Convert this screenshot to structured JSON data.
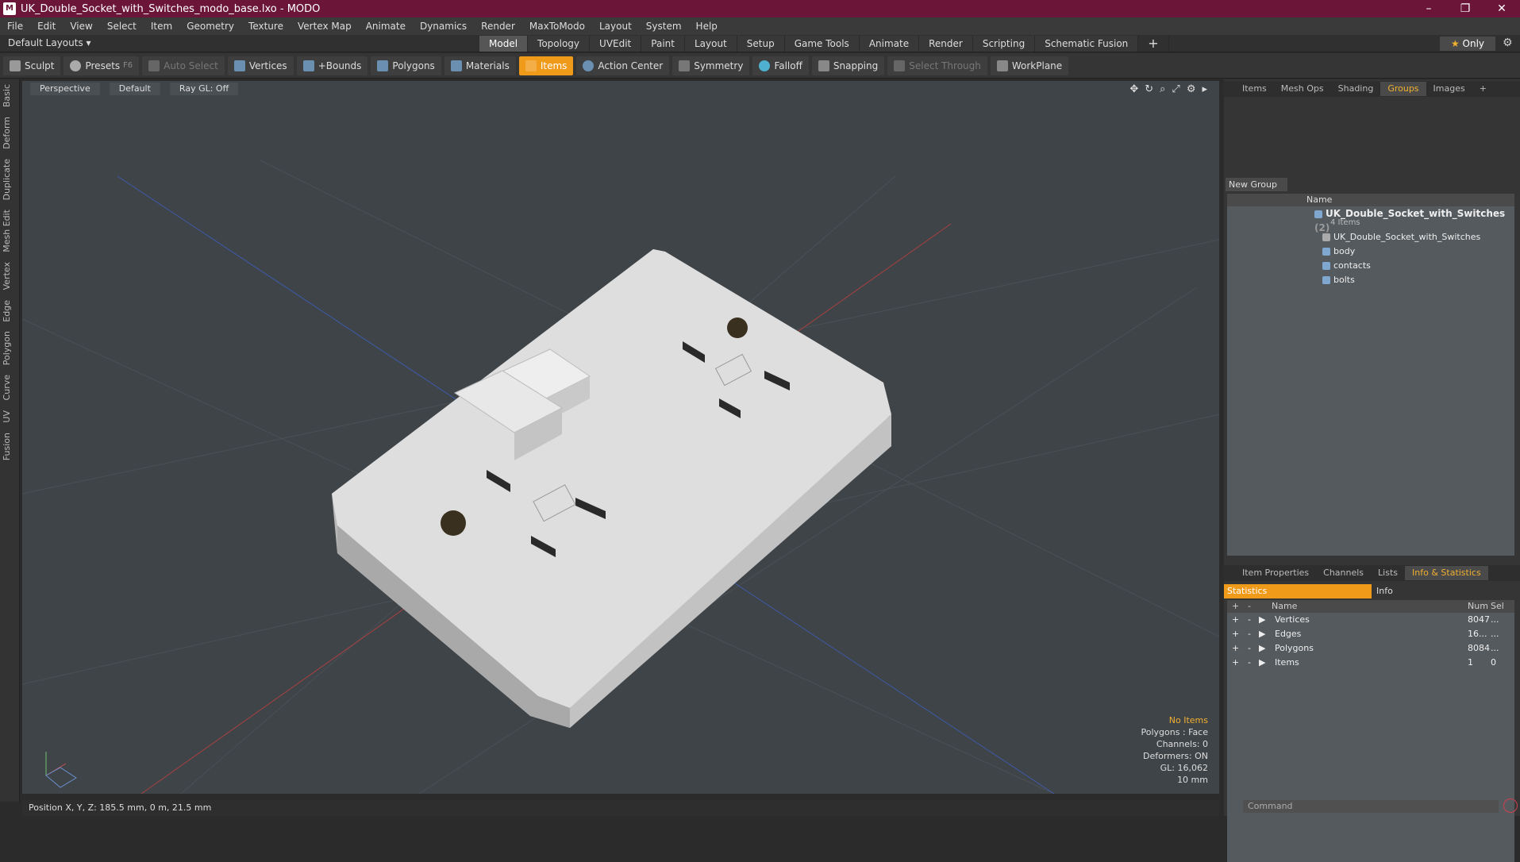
{
  "window": {
    "title": "UK_Double_Socket_with_Switches_modo_base.lxo - MODO",
    "app_icon": "M",
    "minimize": "–",
    "maximize": "❐",
    "close": "✕"
  },
  "menu": [
    "File",
    "Edit",
    "View",
    "Select",
    "Item",
    "Geometry",
    "Texture",
    "Vertex Map",
    "Animate",
    "Dynamics",
    "Render",
    "MaxToModo",
    "Layout",
    "System",
    "Help"
  ],
  "layout_bar": {
    "default_layouts": "Default Layouts ▾",
    "tabs": [
      "Model",
      "Topology",
      "UVEdit",
      "Paint",
      "Layout",
      "Setup",
      "Game Tools",
      "Animate",
      "Render",
      "Scripting",
      "Schematic Fusion"
    ],
    "active_tab": "Model",
    "add_tab": "+",
    "only_star": "★",
    "only_label": "Only",
    "settings_icon": "⚙"
  },
  "toolbar": {
    "sculpt": "Sculpt",
    "presets": "Presets",
    "presets_key": "F6",
    "auto_select": "Auto Select",
    "vertices": "Vertices",
    "bounds": "+Bounds",
    "polygons": "Polygons",
    "materials": "Materials",
    "items": "Items",
    "action_center": "Action Center",
    "symmetry": "Symmetry",
    "falloff": "Falloff",
    "snapping": "Snapping",
    "select_through": "Select Through",
    "workplane": "WorkPlane"
  },
  "sidebar_tabs": [
    "Basic",
    "Deform",
    "Duplicate",
    "Mesh Edit",
    "Vertex",
    "Edge",
    "Polygon",
    "Curve",
    "UV",
    "Fusion"
  ],
  "viewport": {
    "view": "Perspective",
    "shading": "Default",
    "raygl": "Ray GL: Off",
    "nav_icons": [
      "✥",
      "↻",
      "⌕",
      "⤢",
      "⚙",
      "▸"
    ],
    "info": {
      "no_items": "No Items",
      "polygons": "Polygons : Face",
      "channels": "Channels: 0",
      "deformers": "Deformers: ON",
      "gl": "GL: 16,062",
      "scale": "10 mm"
    }
  },
  "status_bar": "Position X, Y, Z:   185.5 mm, 0 m, 21.5 mm",
  "right_panel": {
    "top_tabs": [
      "Items",
      "Mesh Ops",
      "Shading",
      "Groups",
      "Images"
    ],
    "active_top_tab": "Groups",
    "add_tab": "+",
    "new_group": "New Group",
    "groups_header": "Name",
    "groups": [
      {
        "name": "UK_Double_Socket_with_Switches",
        "count": "(2)",
        "sub": "4 Items"
      },
      {
        "name": "UK_Double_Socket_with_Switches"
      },
      {
        "name": "body"
      },
      {
        "name": "contacts"
      },
      {
        "name": "bolts"
      }
    ],
    "bottom_tabs": [
      "Item Properties",
      "Channels",
      "Lists",
      "Info & Statistics"
    ],
    "active_bottom_tab": "Info & Statistics",
    "stat_tab": "Statistics",
    "info_tab": "Info",
    "stats_header": {
      "plus": "+",
      "minus": "-",
      "name": "Name",
      "num": "Num",
      "sel": "Sel"
    },
    "stats": [
      {
        "name": "Vertices",
        "num": "8047",
        "sel": "..."
      },
      {
        "name": "Edges",
        "num": "16...",
        "sel": "..."
      },
      {
        "name": "Polygons",
        "num": "8084",
        "sel": "..."
      },
      {
        "name": "Items",
        "num": "1",
        "sel": "0"
      }
    ],
    "command_placeholder": "Command"
  }
}
